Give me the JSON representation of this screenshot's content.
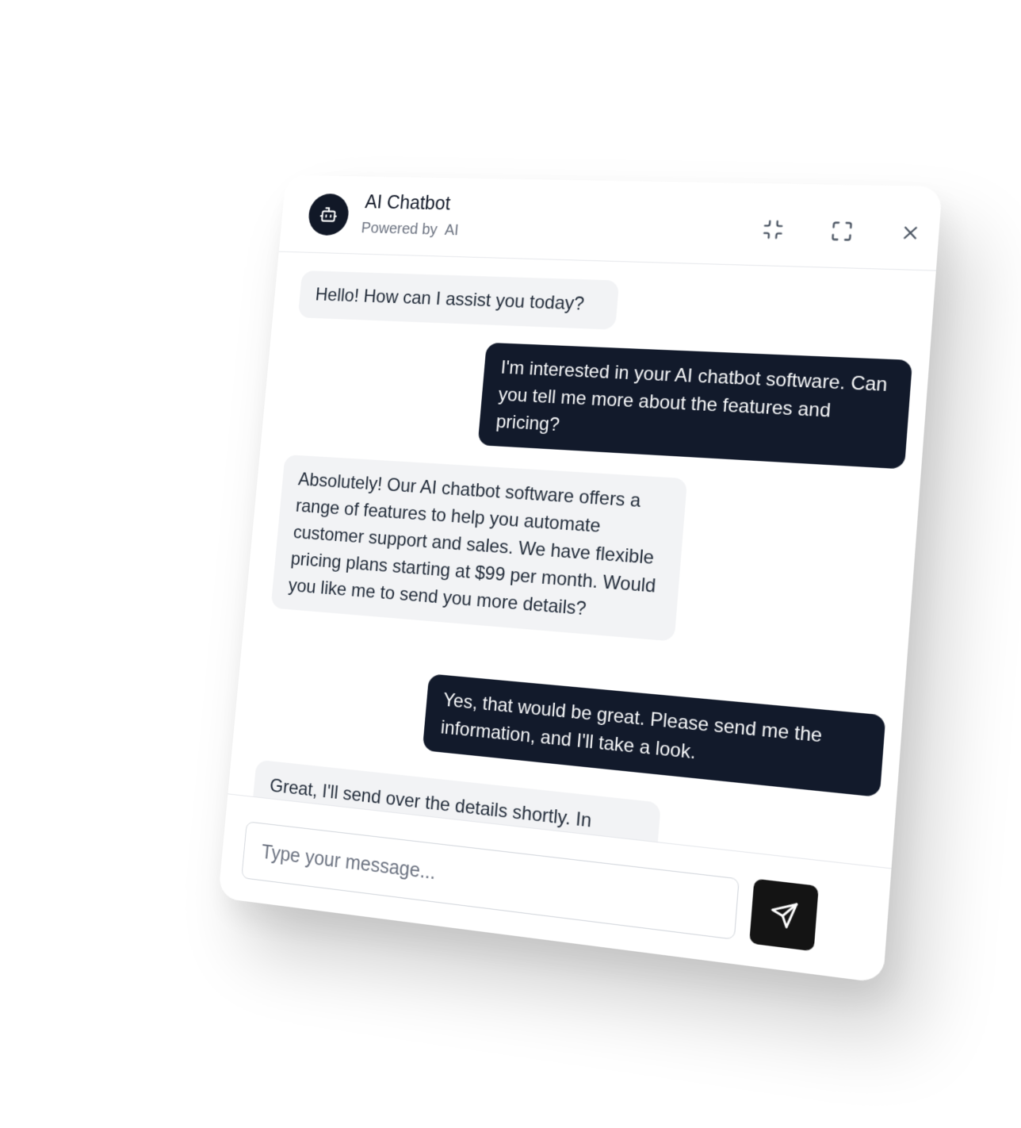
{
  "header": {
    "title": "AI Chatbot",
    "subtitle": "Powered by  AI",
    "avatar_icon": "bot-icon",
    "buttons": {
      "minimize_icon": "minimize-icon",
      "maximize_icon": "maximize-icon",
      "close_icon": "close-icon"
    }
  },
  "messages": [
    {
      "role": "bot",
      "text": "Hello! How can I assist you today?"
    },
    {
      "role": "user",
      "text": "I'm interested in your AI chatbot software. Can you tell me more about the features and pricing?"
    },
    {
      "role": "bot",
      "text": "Absolutely! Our AI chatbot software offers a range of features to help you automate customer support and sales. We have flexible pricing plans starting at $99 per month. Would you like me to send you more details?"
    },
    {
      "role": "user",
      "text": "Yes, that would be great. Please send me the information, and I'll take a look."
    },
    {
      "role": "bot",
      "text": "Great, I'll send over the details shortly. In"
    }
  ],
  "composer": {
    "placeholder": "Type your message...",
    "value": "",
    "send_icon": "send-icon"
  },
  "colors": {
    "dark": "#121a2b",
    "bot_bubble": "#f2f3f5",
    "border": "#e5e7eb",
    "muted_text": "#6b7280"
  }
}
